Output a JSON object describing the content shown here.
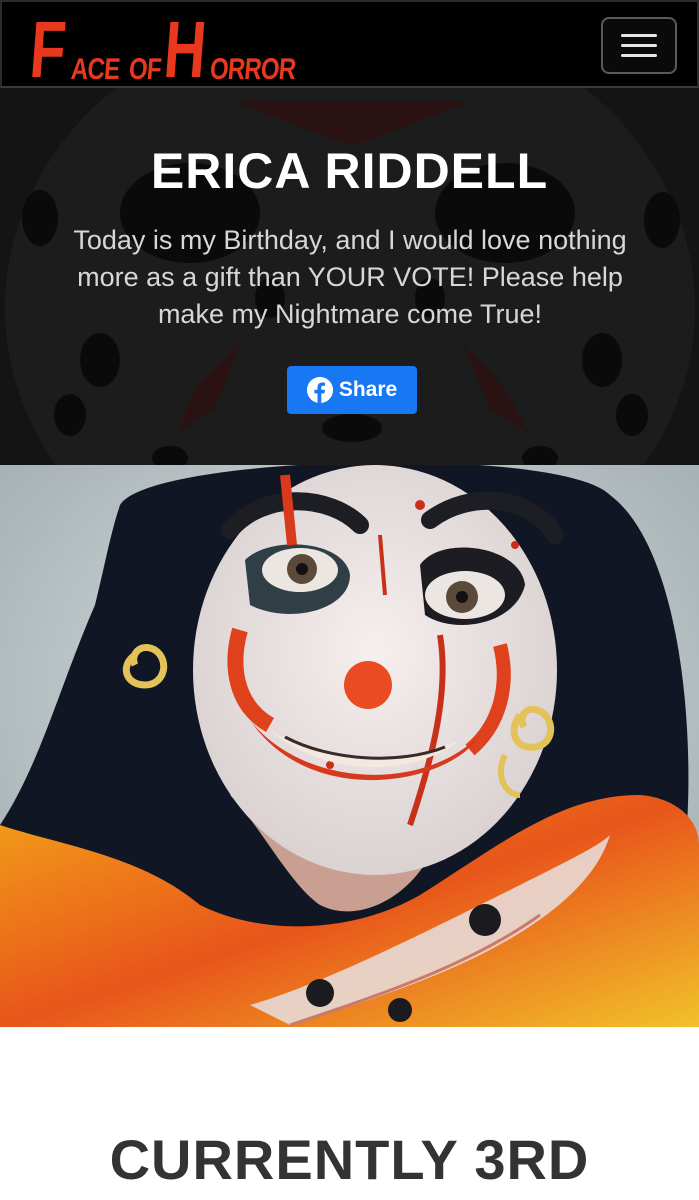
{
  "navbar": {
    "logo_text": "Face of Horror",
    "logo_letters": [
      "F",
      "ACE",
      "OF",
      "H",
      "ORROR"
    ],
    "menu_icon": "hamburger-menu-icon",
    "brand_color": "#e8391e"
  },
  "hero": {
    "title": "ERICA RIDDELL",
    "message": "Today is my Birthday, and I would love nothing more as a gift than YOUR VOTE! Please help make my Nightmare come True!",
    "share_label": "Share",
    "share_icon": "facebook-icon",
    "share_color": "#1877f2",
    "background_icon": "hockey-mask-icon"
  },
  "photo": {
    "alt": "Contestant photo in bloody clown makeup"
  },
  "status": {
    "rank_text": "CURRENTLY 3RD"
  }
}
